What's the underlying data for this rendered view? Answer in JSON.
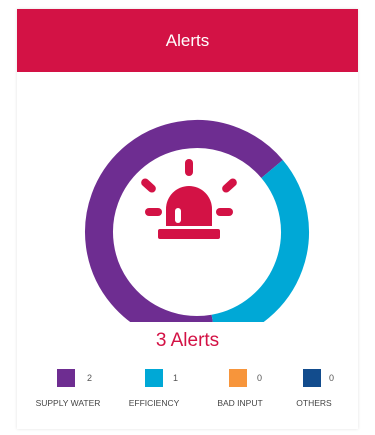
{
  "header": {
    "title": "Alerts"
  },
  "summary": {
    "count_label": "3 Alerts"
  },
  "colors": {
    "header_bg": "#d31245",
    "accent": "#d31245"
  },
  "icon": "siren-icon",
  "legend": [
    {
      "label": "SUPPLY WATER",
      "value": "2",
      "color": "#6e2d91"
    },
    {
      "label": "EFFICIENCY",
      "value": "1",
      "color": "#00a8d6"
    },
    {
      "label": "BAD INPUT",
      "value": "0",
      "color": "#f7953b"
    },
    {
      "label": "OTHERS",
      "value": "0",
      "color": "#124c8d"
    }
  ]
}
